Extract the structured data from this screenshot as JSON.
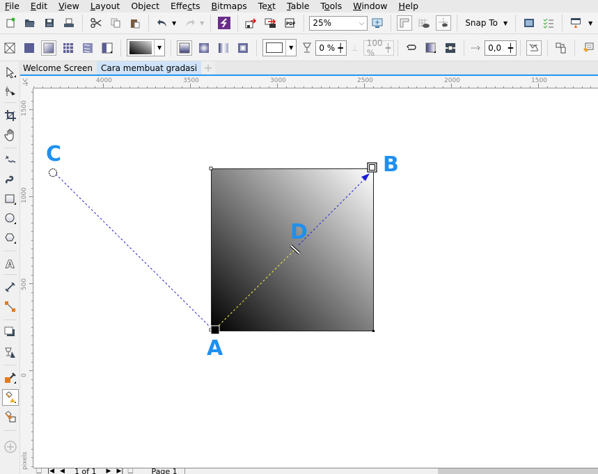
{
  "menu": [
    {
      "label": "File",
      "u": "F",
      "rest": "ile"
    },
    {
      "label": "Edit",
      "u": "E",
      "rest": "dit"
    },
    {
      "label": "View",
      "u": "V",
      "rest": "iew"
    },
    {
      "label": "Layout",
      "u": "L",
      "rest": "ayout"
    },
    {
      "label": "Object",
      "u": "",
      "rest": "Object"
    },
    {
      "label": "Effects",
      "pre": "Effe",
      "u": "c",
      "rest": "ts"
    },
    {
      "label": "Bitmaps",
      "u": "B",
      "rest": "itmaps"
    },
    {
      "label": "Text",
      "pre": "Te",
      "u": "x",
      "rest": "t"
    },
    {
      "label": "Table",
      "u": "T",
      "rest": "able"
    },
    {
      "label": "Tools",
      "pre": "T",
      "u": "o",
      "rest": "ols"
    },
    {
      "label": "Window",
      "u": "W",
      "rest": "indow"
    },
    {
      "label": "Help",
      "u": "H",
      "rest": "elp"
    }
  ],
  "standard_toolbar": {
    "zoom_level": "25%",
    "snap_to_label": "Snap To",
    "icons": [
      "new-document",
      "open",
      "save",
      "print",
      "cut",
      "copy",
      "paste",
      "undo",
      "redo",
      "corel-connect",
      "import",
      "export",
      "publish-pdf",
      "zoom-fit",
      "rulers",
      "grid-view",
      "guidelines-view",
      "welcome-screen",
      "options",
      "launch"
    ]
  },
  "property_bar": {
    "fill_types": [
      "no-fill",
      "uniform-fill",
      "fountain-fill",
      "vector-pattern-fill",
      "texture-fill",
      "postscript-fill"
    ],
    "fountain_types": [
      "linear",
      "elliptical",
      "conical",
      "rectangular"
    ],
    "transparency_value": "0 %",
    "node_position_value": "100 %",
    "rotation_value": "0,0"
  },
  "tabs": [
    {
      "label": "Welcome Screen",
      "active": false
    },
    {
      "label": "Cara membuat gradasi",
      "active": true
    }
  ],
  "rulers": {
    "horizontal_ticks": [
      "4000",
      "3500",
      "3000",
      "2500",
      "2000",
      "1500"
    ],
    "vertical_ticks": [
      "1500",
      "1000",
      "500",
      "0"
    ],
    "unit_label": "pixels"
  },
  "canvas": {
    "annotations": [
      "A",
      "B",
      "C",
      "D"
    ],
    "gradient": {
      "start_color": "#000000",
      "end_color": "#ffffff",
      "type": "linear"
    },
    "accent_color": "#1e90ef"
  },
  "status_bar": {
    "page_indicator": "1 of 1",
    "page_tab": "Page 1"
  }
}
